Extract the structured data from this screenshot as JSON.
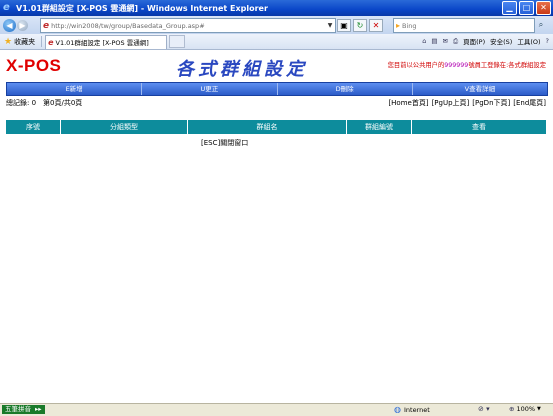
{
  "window": {
    "title": "V1.01群組設定 [X-POS 雲通網] - Windows Internet Explorer"
  },
  "address_bar": {
    "url": "http://win2008/tw/group/Basedata_Group.asp#",
    "search_placeholder": "Bing"
  },
  "favorites_bar": {
    "favorites_label": "收藏夹",
    "tab_title": "V1.01群組設定 [X-POS 雲通網]",
    "commands": [
      "頁面(P)",
      "安全(S)",
      "工具(O)"
    ]
  },
  "page": {
    "logo": "X-POS",
    "heading": "各式群組設定",
    "user_info_prefix": "您目前以",
    "user_info_company": "公共用户",
    "user_info_de": "的",
    "user_info_uid": "999999",
    "user_info_middle": "號員工登錄在:",
    "user_info_module": "各式群組設定",
    "function_buttons": [
      "E新增",
      "U更正",
      "D刪除",
      "V查看詳細"
    ],
    "record_info": "總記錄: 0　第0頁/共0頁",
    "pager": [
      "[Home首頁]",
      "[PgUp上頁]",
      "[PgDn下頁]",
      "[End尾頁]"
    ],
    "columns": [
      "序號",
      "分組類型",
      "群組名",
      "群組編號",
      "查看"
    ],
    "close_link": "[ESC]關閉窗口"
  },
  "status_bar": {
    "ime": "五筆拼音",
    "zone": "Internet",
    "zoom": "100%"
  },
  "colors": {
    "logo": "#e00000",
    "heading": "#2a48c0",
    "function_bar": "#3a6fd8",
    "grid_header": "#0d8c9c",
    "title_bar": "#0a46c8"
  }
}
